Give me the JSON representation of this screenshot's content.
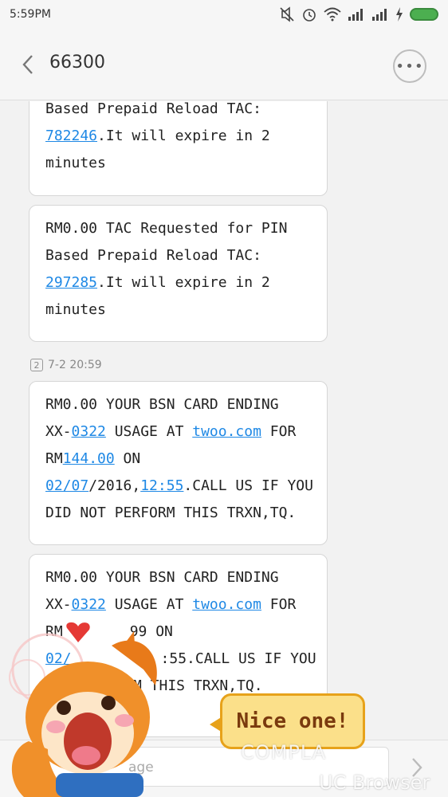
{
  "status_bar": {
    "time": "5:59PM"
  },
  "app_bar": {
    "title": "66300",
    "more_label": "•••"
  },
  "messages": [
    {
      "lines": [
        {
          "text": "Based Prepaid Reload TAC:"
        },
        {
          "link": "782246",
          "rest": ".It will expire in 2"
        },
        {
          "text": "minutes"
        }
      ]
    },
    {
      "lines": [
        {
          "text": "RM0.00 TAC Requested for PIN"
        },
        {
          "text": "Based Prepaid Reload TAC:"
        },
        {
          "link": "297285",
          "rest": ".It will expire in 2"
        },
        {
          "text": "minutes"
        }
      ]
    },
    {
      "lines": [
        {
          "text": "RM0.00 YOUR BSN CARD ENDING"
        },
        {
          "pre": "XX-",
          "link": "0322",
          "mid": " USAGE AT ",
          "link2": "twoo.com",
          "rest": " FOR"
        },
        {
          "pre": "RM",
          "link": "144.00",
          "rest": " ON"
        },
        {
          "link": "02/07",
          "mid": "/2016,",
          "link2": "12:55",
          "rest": ".CALL US IF YOU"
        },
        {
          "text": "DID NOT PERFORM THIS TRXN,TQ."
        }
      ]
    },
    {
      "lines": [
        {
          "text": "RM0.00 YOUR BSN CARD ENDING"
        },
        {
          "pre": "XX-",
          "link": "0322",
          "mid": " USAGE AT ",
          "link2": "twoo.com",
          "rest": " FOR"
        },
        {
          "pre": "RM",
          "link": "",
          "rest": "99 ON"
        },
        {
          "link": "02/",
          "rest": ":55.CALL US IF YOU"
        },
        {
          "text": "M THIS TRXN,TQ."
        }
      ]
    }
  ],
  "timestamp": {
    "sim": "2",
    "time": "7-2 20:59"
  },
  "compose": {
    "placeholder": "age"
  },
  "overlay": {
    "speech": "Nice one!",
    "watermark_top": "COMPLA",
    "watermark_bottom": "UC Browser"
  },
  "colors": {
    "link": "#1e88e5",
    "bubble": "#ffffff",
    "background": "#f2f2f2",
    "battery": "#4caf50"
  }
}
